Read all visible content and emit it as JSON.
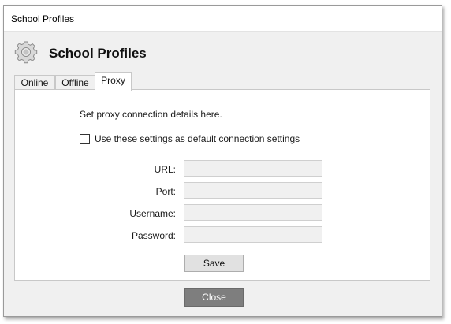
{
  "window": {
    "title": "School Profiles"
  },
  "header": {
    "icon": "gear-icon",
    "title": "School Profiles"
  },
  "tabs": [
    {
      "label": "Online",
      "active": false
    },
    {
      "label": "Offline",
      "active": false
    },
    {
      "label": "Proxy",
      "active": true
    }
  ],
  "proxy": {
    "intro": "Set proxy connection details here.",
    "default_checkbox": {
      "label": "Use these settings as default connection settings",
      "checked": false
    },
    "fields": [
      {
        "label": "URL:",
        "value": ""
      },
      {
        "label": "Port:",
        "value": ""
      },
      {
        "label": "Username:",
        "value": ""
      },
      {
        "label": "Password:",
        "value": ""
      }
    ],
    "save_label": "Save"
  },
  "footer": {
    "close_label": "Close"
  },
  "colors": {
    "dialog_bg": "#f0f0f0",
    "panel_bg": "#ffffff",
    "close_button_bg": "#7e7e7e",
    "input_bg": "#f0f0f0"
  }
}
